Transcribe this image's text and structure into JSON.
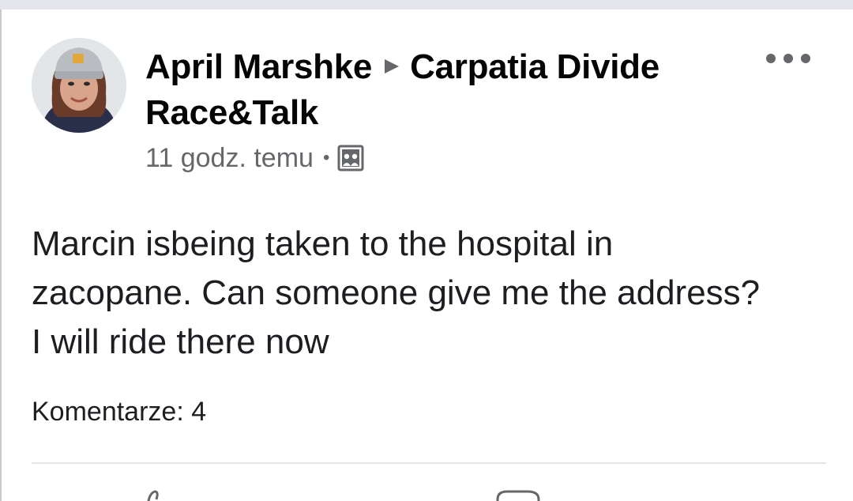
{
  "post": {
    "author": "April Marshke",
    "group": "Carpatia Divide Race&Talk",
    "timestamp": "11 godz. temu",
    "separator": "•",
    "audience_icon": "photo-gallery-icon",
    "text": "Marcin isbeing taken to the hospital in\nzacopane. Can someone give me the address?\nI will ride there now",
    "comments_label": "Komentarze: 4",
    "more_icon": "more-horizontal-icon"
  },
  "actions": {
    "like_icon": "like-icon",
    "comment_icon": "comment-icon"
  },
  "colors": {
    "text_primary": "#050505",
    "text_secondary": "#65676b",
    "divider": "#e4e6eb",
    "background": "#ffffff"
  }
}
